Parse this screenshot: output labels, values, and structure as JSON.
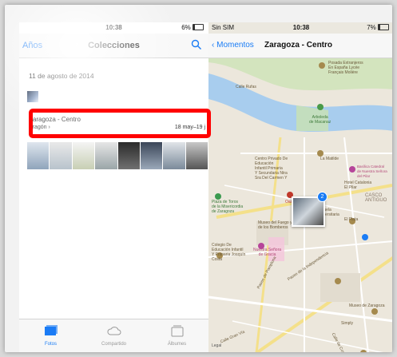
{
  "left": {
    "status": {
      "time": "10:38",
      "battery": "6%"
    },
    "nav": {
      "back_label": "Años",
      "title": "Colecciones"
    },
    "date_header": "11 de agosto de 2014",
    "section": {
      "title": "Zaragoza - Centro",
      "subtitle": "Aragón",
      "range": "18 may–19 j"
    },
    "tabs": [
      {
        "label": "Fotos"
      },
      {
        "label": "Compartido"
      },
      {
        "label": "Álbumes"
      }
    ]
  },
  "right": {
    "status": {
      "carrier": "Sin SIM",
      "time": "10:38",
      "battery": "7%"
    },
    "nav": {
      "back_label": "Momentos",
      "title": "Zaragoza - Centro"
    },
    "map_labels": {
      "hotel_espana": "Posada Extranjeros\nEn España Lycée\nFrançais Molière",
      "arboleda": "Arboleda\nde Macanaz",
      "calle_rufas": "Calle Rufas",
      "colegio_educacion": "Centro Privado De\nEducación\nInfantil Primaria\nY Secundaria Ntra\nSra Del Carmen Y",
      "la_matilde": "La Matilde",
      "basilica": "Basílica Catedral\nde Nuestra Señora\ndel Pilar",
      "hotel_catalonia": "Hotel Catalonia\nEl Pilar",
      "casco": "CASCO\nANTIGUO",
      "oasis": "Oasis",
      "plaza_toros": "Plaza de Toros\nde la Misericordia\nde Zaragoza",
      "escuela": "Escuela\nUniversitaria",
      "museo_bomberos": "Museo del Fuego y\nde los Bomberos",
      "el_plata": "El Plata",
      "colegio_infantil": "Colegio De\nEducación Infantil\nY Primaria Joaquín\nCosta",
      "nuestra_senora": "Nuestra Señora\nde Gracia",
      "paseo_pamplona": "Paseo de Pamplona",
      "paseo_independencia": "Paseo de la Independencia",
      "museo_zaragoza": "Museo de Zaragoza",
      "simply": "Simply",
      "calle_gran_via": "Calle Gran Vía",
      "calle_costa": "Calle de Costa",
      "legal": "Legal"
    },
    "photo_count": "2"
  }
}
